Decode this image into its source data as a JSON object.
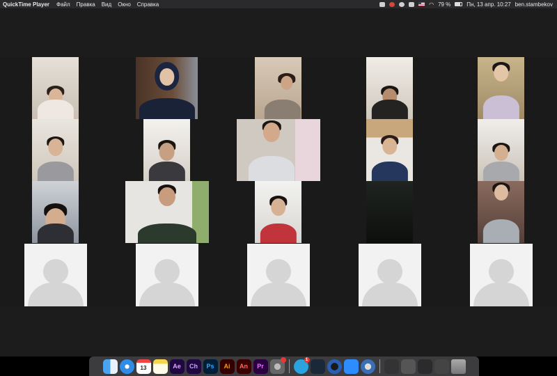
{
  "menubar": {
    "app_name": "QuickTime Player",
    "menu_items": [
      "Файл",
      "Правка",
      "Вид",
      "Окно",
      "Справка"
    ],
    "battery_text": "79 %",
    "battery_level": 0.79,
    "datetime": "Пн, 13 апр.  10:27",
    "username": "ben.stambekov"
  },
  "dock": {
    "calendar_day": "13",
    "apps": [
      {
        "name": "finder",
        "label": ""
      },
      {
        "name": "safari",
        "label": ""
      },
      {
        "name": "calendar",
        "label": "13"
      },
      {
        "name": "notes",
        "label": ""
      },
      {
        "name": "after-effects",
        "label": "Ae"
      },
      {
        "name": "character-animator",
        "label": "Ch"
      },
      {
        "name": "photoshop",
        "label": "Ps"
      },
      {
        "name": "illustrator",
        "label": "Ai"
      },
      {
        "name": "animate",
        "label": "An"
      },
      {
        "name": "premiere",
        "label": "Pr"
      },
      {
        "name": "system-preferences",
        "label": ""
      },
      {
        "name": "telegram",
        "label": "",
        "badge": "1"
      },
      {
        "name": "steam",
        "label": ""
      },
      {
        "name": "cinema-4d",
        "label": ""
      },
      {
        "name": "zoom",
        "label": ""
      },
      {
        "name": "quicktime",
        "label": ""
      }
    ]
  },
  "colors": {
    "menubar_bg": "#2a2a2c",
    "stage_bg": "#1a1a1a",
    "avatar_bg": "#f2f2f2",
    "avatar_silhouette": "#d5d5d5"
  }
}
